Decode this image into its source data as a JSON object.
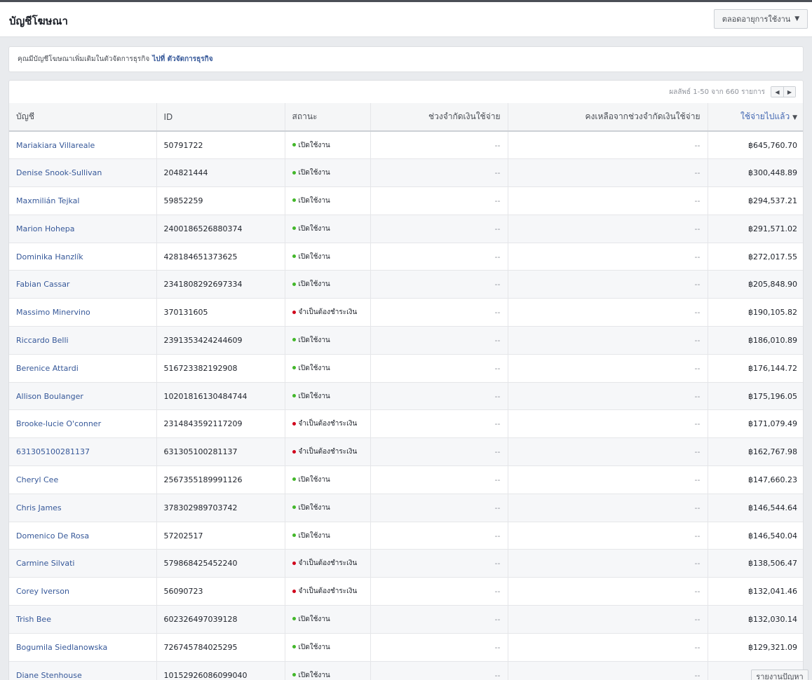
{
  "header": {
    "title": "บัญชีโฆษณา",
    "range_label": "ตลอดอายุการใช้งาน"
  },
  "notice": {
    "text": "คุณมีบัญชีโฆษณาเพิ่มเติมในตัวจัดการธุรกิจ",
    "link": "ไปที่ ตัวจัดการธุรกิจ"
  },
  "pager": {
    "text": "ผลลัพธ์ 1-50 จาก 660 รายการ"
  },
  "columns": {
    "account": "บัญชี",
    "id": "ID",
    "status": "สถานะ",
    "limit": "ช่วงจำกัดเงินใช้จ่าย",
    "remaining": "คงเหลือจากช่วงจำกัดเงินใช้จ่าย",
    "spent": "ใช้จ่ายไปแล้ว"
  },
  "status_colors": {
    "active": "#42b72a",
    "payment": "#d0021b",
    "accent": "#4267b2"
  },
  "rows": [
    {
      "name": "Mariakiara Villareale",
      "id": "50791722",
      "status": "เปิดใช้งาน",
      "status_type": "active",
      "limit": "--",
      "remaining": "--",
      "spent": "฿645,760.70"
    },
    {
      "name": "Denise Snook-Sullivan",
      "id": "204821444",
      "status": "เปิดใช้งาน",
      "status_type": "active",
      "limit": "--",
      "remaining": "--",
      "spent": "฿300,448.89"
    },
    {
      "name": "Maxmilián Tejkal",
      "id": "59852259",
      "status": "เปิดใช้งาน",
      "status_type": "active",
      "limit": "--",
      "remaining": "--",
      "spent": "฿294,537.21"
    },
    {
      "name": "Marion Hohepa",
      "id": "2400186526880374",
      "status": "เปิดใช้งาน",
      "status_type": "active",
      "limit": "--",
      "remaining": "--",
      "spent": "฿291,571.02"
    },
    {
      "name": "Dominika Hanzlík",
      "id": "428184651373625",
      "status": "เปิดใช้งาน",
      "status_type": "active",
      "limit": "--",
      "remaining": "--",
      "spent": "฿272,017.55"
    },
    {
      "name": "Fabian Cassar",
      "id": "2341808292697334",
      "status": "เปิดใช้งาน",
      "status_type": "active",
      "limit": "--",
      "remaining": "--",
      "spent": "฿205,848.90"
    },
    {
      "name": "Massimo Minervino",
      "id": "370131605",
      "status": "จำเป็นต้องชำระเงิน",
      "status_type": "payment",
      "limit": "--",
      "remaining": "--",
      "spent": "฿190,105.82"
    },
    {
      "name": "Riccardo Belli",
      "id": "2391353424244609",
      "status": "เปิดใช้งาน",
      "status_type": "active",
      "limit": "--",
      "remaining": "--",
      "spent": "฿186,010.89"
    },
    {
      "name": "Berenice Attardi",
      "id": "516723382192908",
      "status": "เปิดใช้งาน",
      "status_type": "active",
      "limit": "--",
      "remaining": "--",
      "spent": "฿176,144.72"
    },
    {
      "name": "Allison Boulanger",
      "id": "10201816130484744",
      "status": "เปิดใช้งาน",
      "status_type": "active",
      "limit": "--",
      "remaining": "--",
      "spent": "฿175,196.05"
    },
    {
      "name": "Brooke-lucie O'conner",
      "id": "2314843592117209",
      "status": "จำเป็นต้องชำระเงิน",
      "status_type": "payment",
      "limit": "--",
      "remaining": "--",
      "spent": "฿171,079.49"
    },
    {
      "name": "631305100281137",
      "id": "631305100281137",
      "status": "จำเป็นต้องชำระเงิน",
      "status_type": "payment",
      "limit": "--",
      "remaining": "--",
      "spent": "฿162,767.98"
    },
    {
      "name": "Cheryl Cee",
      "id": "2567355189991126",
      "status": "เปิดใช้งาน",
      "status_type": "active",
      "limit": "--",
      "remaining": "--",
      "spent": "฿147,660.23"
    },
    {
      "name": "Chris James",
      "id": "378302989703742",
      "status": "เปิดใช้งาน",
      "status_type": "active",
      "limit": "--",
      "remaining": "--",
      "spent": "฿146,544.64"
    },
    {
      "name": "Domenico De Rosa",
      "id": "57202517",
      "status": "เปิดใช้งาน",
      "status_type": "active",
      "limit": "--",
      "remaining": "--",
      "spent": "฿146,540.04"
    },
    {
      "name": "Carmine Silvati",
      "id": "579868425452240",
      "status": "จำเป็นต้องชำระเงิน",
      "status_type": "payment",
      "limit": "--",
      "remaining": "--",
      "spent": "฿138,506.47"
    },
    {
      "name": "Corey Iverson",
      "id": "56090723",
      "status": "จำเป็นต้องชำระเงิน",
      "status_type": "payment",
      "limit": "--",
      "remaining": "--",
      "spent": "฿132,041.46"
    },
    {
      "name": "Trish Bee",
      "id": "602326497039128",
      "status": "เปิดใช้งาน",
      "status_type": "active",
      "limit": "--",
      "remaining": "--",
      "spent": "฿132,030.14"
    },
    {
      "name": "Bogumila Siedlanowska",
      "id": "726745784025295",
      "status": "เปิดใช้งาน",
      "status_type": "active",
      "limit": "--",
      "remaining": "--",
      "spent": "฿129,321.09"
    },
    {
      "name": "Diane Stenhouse",
      "id": "10152926086099040",
      "status": "เปิดใช้งาน",
      "status_type": "active",
      "limit": "--",
      "remaining": "--",
      "spent": ""
    }
  ],
  "report_button": "รายงานปัญหา"
}
